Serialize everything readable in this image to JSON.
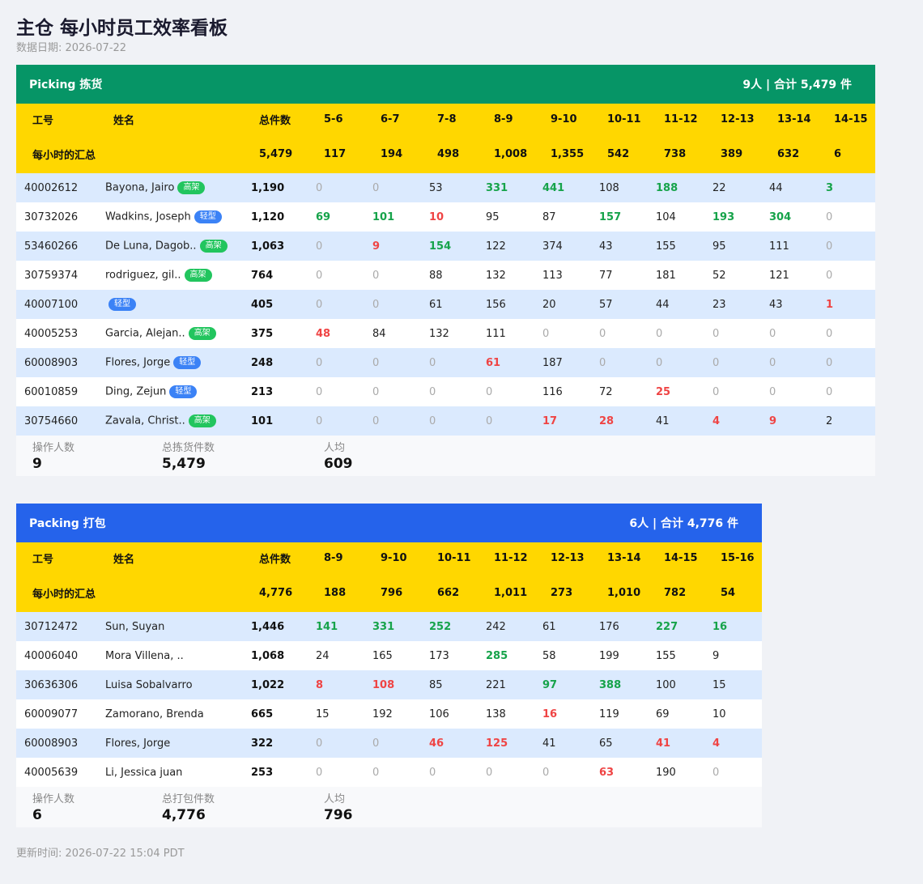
{
  "page": {
    "title": "主仓 每小时员工效率看板",
    "date_label": "数据日期: 2026-07-22",
    "footer": "更新时间: 2026-07-22 15:04 PDT"
  },
  "colors": {
    "picking": "#069566",
    "packing": "#2563eb",
    "header_row": "#ffd700",
    "good": "#16a34a",
    "bad": "#ef4444"
  },
  "picking": {
    "name": "Picking 拣货",
    "summary_right": "9人 | 合计 5,479 件",
    "columns": [
      "工号",
      "姓名",
      "总件数",
      "5-6",
      "6-7",
      "7-8",
      "8-9",
      "9-10",
      "10-11",
      "11-12",
      "12-13",
      "13-14",
      "14-15"
    ],
    "totals_label": "每小时的汇总",
    "totals": [
      "5,479",
      "117",
      "194",
      "498",
      "1,008",
      "1,355",
      "542",
      "738",
      "389",
      "632",
      "6"
    ],
    "rows": [
      {
        "id": "40002612",
        "name": "Bayona, Jairo",
        "badge": "高架",
        "badge_type": "high",
        "total": "1,190",
        "hours": [
          [
            "0",
            "zero"
          ],
          [
            "0",
            "zero"
          ],
          [
            "53",
            "norm"
          ],
          [
            "331",
            "green"
          ],
          [
            "441",
            "green"
          ],
          [
            "108",
            "norm"
          ],
          [
            "188",
            "green"
          ],
          [
            "22",
            "norm"
          ],
          [
            "44",
            "norm"
          ],
          [
            "3",
            "green"
          ]
        ]
      },
      {
        "id": "30732026",
        "name": "Wadkins, Joseph",
        "badge": "轻型",
        "badge_type": "light",
        "total": "1,120",
        "hours": [
          [
            "69",
            "green"
          ],
          [
            "101",
            "green"
          ],
          [
            "10",
            "red"
          ],
          [
            "95",
            "norm"
          ],
          [
            "87",
            "norm"
          ],
          [
            "157",
            "green"
          ],
          [
            "104",
            "norm"
          ],
          [
            "193",
            "green"
          ],
          [
            "304",
            "green"
          ],
          [
            "0",
            "zero"
          ]
        ]
      },
      {
        "id": "53460266",
        "name": "De Luna, Dagob..",
        "badge": "高架",
        "badge_type": "high",
        "total": "1,063",
        "hours": [
          [
            "0",
            "zero"
          ],
          [
            "9",
            "red"
          ],
          [
            "154",
            "green"
          ],
          [
            "122",
            "norm"
          ],
          [
            "374",
            "norm"
          ],
          [
            "43",
            "norm"
          ],
          [
            "155",
            "norm"
          ],
          [
            "95",
            "norm"
          ],
          [
            "111",
            "norm"
          ],
          [
            "0",
            "zero"
          ]
        ]
      },
      {
        "id": "30759374",
        "name": "rodriguez, gil..",
        "badge": "高架",
        "badge_type": "high",
        "total": "764",
        "hours": [
          [
            "0",
            "zero"
          ],
          [
            "0",
            "zero"
          ],
          [
            "88",
            "norm"
          ],
          [
            "132",
            "norm"
          ],
          [
            "113",
            "norm"
          ],
          [
            "77",
            "norm"
          ],
          [
            "181",
            "norm"
          ],
          [
            "52",
            "norm"
          ],
          [
            "121",
            "norm"
          ],
          [
            "0",
            "zero"
          ]
        ]
      },
      {
        "id": "40007100",
        "name": "",
        "badge": "轻型",
        "badge_type": "light",
        "total": "405",
        "hours": [
          [
            "0",
            "zero"
          ],
          [
            "0",
            "zero"
          ],
          [
            "61",
            "norm"
          ],
          [
            "156",
            "norm"
          ],
          [
            "20",
            "norm"
          ],
          [
            "57",
            "norm"
          ],
          [
            "44",
            "norm"
          ],
          [
            "23",
            "norm"
          ],
          [
            "43",
            "norm"
          ],
          [
            "1",
            "red"
          ]
        ]
      },
      {
        "id": "40005253",
        "name": "Garcia, Alejan..",
        "badge": "高架",
        "badge_type": "high",
        "total": "375",
        "hours": [
          [
            "48",
            "red"
          ],
          [
            "84",
            "norm"
          ],
          [
            "132",
            "norm"
          ],
          [
            "111",
            "norm"
          ],
          [
            "0",
            "zero"
          ],
          [
            "0",
            "zero"
          ],
          [
            "0",
            "zero"
          ],
          [
            "0",
            "zero"
          ],
          [
            "0",
            "zero"
          ],
          [
            "0",
            "zero"
          ]
        ]
      },
      {
        "id": "60008903",
        "name": "Flores, Jorge",
        "badge": "轻型",
        "badge_type": "light",
        "total": "248",
        "hours": [
          [
            "0",
            "zero"
          ],
          [
            "0",
            "zero"
          ],
          [
            "0",
            "zero"
          ],
          [
            "61",
            "red"
          ],
          [
            "187",
            "norm"
          ],
          [
            "0",
            "zero"
          ],
          [
            "0",
            "zero"
          ],
          [
            "0",
            "zero"
          ],
          [
            "0",
            "zero"
          ],
          [
            "0",
            "zero"
          ]
        ]
      },
      {
        "id": "60010859",
        "name": "Ding, Zejun",
        "badge": "轻型",
        "badge_type": "light",
        "total": "213",
        "hours": [
          [
            "0",
            "zero"
          ],
          [
            "0",
            "zero"
          ],
          [
            "0",
            "zero"
          ],
          [
            "0",
            "zero"
          ],
          [
            "116",
            "norm"
          ],
          [
            "72",
            "norm"
          ],
          [
            "25",
            "red"
          ],
          [
            "0",
            "zero"
          ],
          [
            "0",
            "zero"
          ],
          [
            "0",
            "zero"
          ]
        ]
      },
      {
        "id": "30754660",
        "name": "Zavala, Christ..",
        "badge": "高架",
        "badge_type": "high",
        "total": "101",
        "hours": [
          [
            "0",
            "zero"
          ],
          [
            "0",
            "zero"
          ],
          [
            "0",
            "zero"
          ],
          [
            "0",
            "zero"
          ],
          [
            "17",
            "red"
          ],
          [
            "28",
            "red"
          ],
          [
            "41",
            "norm"
          ],
          [
            "4",
            "red"
          ],
          [
            "9",
            "red"
          ],
          [
            "2",
            "norm"
          ]
        ]
      }
    ],
    "stats": [
      {
        "label": "操作人数",
        "value": "9"
      },
      {
        "label": "总拣货件数",
        "value": "5,479"
      },
      {
        "label": "人均",
        "value": "609"
      }
    ]
  },
  "packing": {
    "name": "Packing 打包",
    "summary_right": "6人 | 合计 4,776 件",
    "columns": [
      "工号",
      "姓名",
      "总件数",
      "8-9",
      "9-10",
      "10-11",
      "11-12",
      "12-13",
      "13-14",
      "14-15",
      "15-16"
    ],
    "totals_label": "每小时的汇总",
    "totals": [
      "4,776",
      "188",
      "796",
      "662",
      "1,011",
      "273",
      "1,010",
      "782",
      "54"
    ],
    "rows": [
      {
        "id": "30712472",
        "name": "Sun, Suyan",
        "badge": "",
        "badge_type": "",
        "total": "1,446",
        "hours": [
          [
            "141",
            "green"
          ],
          [
            "331",
            "green"
          ],
          [
            "252",
            "green"
          ],
          [
            "242",
            "norm"
          ],
          [
            "61",
            "norm"
          ],
          [
            "176",
            "norm"
          ],
          [
            "227",
            "green"
          ],
          [
            "16",
            "green"
          ]
        ]
      },
      {
        "id": "40006040",
        "name": "Mora Villena, ..",
        "badge": "",
        "badge_type": "",
        "total": "1,068",
        "hours": [
          [
            "24",
            "norm"
          ],
          [
            "165",
            "norm"
          ],
          [
            "173",
            "norm"
          ],
          [
            "285",
            "green"
          ],
          [
            "58",
            "norm"
          ],
          [
            "199",
            "norm"
          ],
          [
            "155",
            "norm"
          ],
          [
            "9",
            "norm"
          ]
        ]
      },
      {
        "id": "30636306",
        "name": "Luisa Sobalvarro",
        "badge": "",
        "badge_type": "",
        "total": "1,022",
        "hours": [
          [
            "8",
            "red"
          ],
          [
            "108",
            "red"
          ],
          [
            "85",
            "norm"
          ],
          [
            "221",
            "norm"
          ],
          [
            "97",
            "green"
          ],
          [
            "388",
            "green"
          ],
          [
            "100",
            "norm"
          ],
          [
            "15",
            "norm"
          ]
        ]
      },
      {
        "id": "60009077",
        "name": "Zamorano, Brenda",
        "badge": "",
        "badge_type": "",
        "total": "665",
        "hours": [
          [
            "15",
            "norm"
          ],
          [
            "192",
            "norm"
          ],
          [
            "106",
            "norm"
          ],
          [
            "138",
            "norm"
          ],
          [
            "16",
            "red"
          ],
          [
            "119",
            "norm"
          ],
          [
            "69",
            "norm"
          ],
          [
            "10",
            "norm"
          ]
        ]
      },
      {
        "id": "60008903",
        "name": "Flores, Jorge",
        "badge": "",
        "badge_type": "",
        "total": "322",
        "hours": [
          [
            "0",
            "zero"
          ],
          [
            "0",
            "zero"
          ],
          [
            "46",
            "red"
          ],
          [
            "125",
            "red"
          ],
          [
            "41",
            "norm"
          ],
          [
            "65",
            "norm"
          ],
          [
            "41",
            "red"
          ],
          [
            "4",
            "red"
          ]
        ]
      },
      {
        "id": "40005639",
        "name": "Li, Jessica juan",
        "badge": "",
        "badge_type": "",
        "total": "253",
        "hours": [
          [
            "0",
            "zero"
          ],
          [
            "0",
            "zero"
          ],
          [
            "0",
            "zero"
          ],
          [
            "0",
            "zero"
          ],
          [
            "0",
            "zero"
          ],
          [
            "63",
            "red"
          ],
          [
            "190",
            "norm"
          ],
          [
            "0",
            "zero"
          ]
        ]
      }
    ],
    "stats": [
      {
        "label": "操作人数",
        "value": "6"
      },
      {
        "label": "总打包件数",
        "value": "4,776"
      },
      {
        "label": "人均",
        "value": "796"
      }
    ]
  }
}
